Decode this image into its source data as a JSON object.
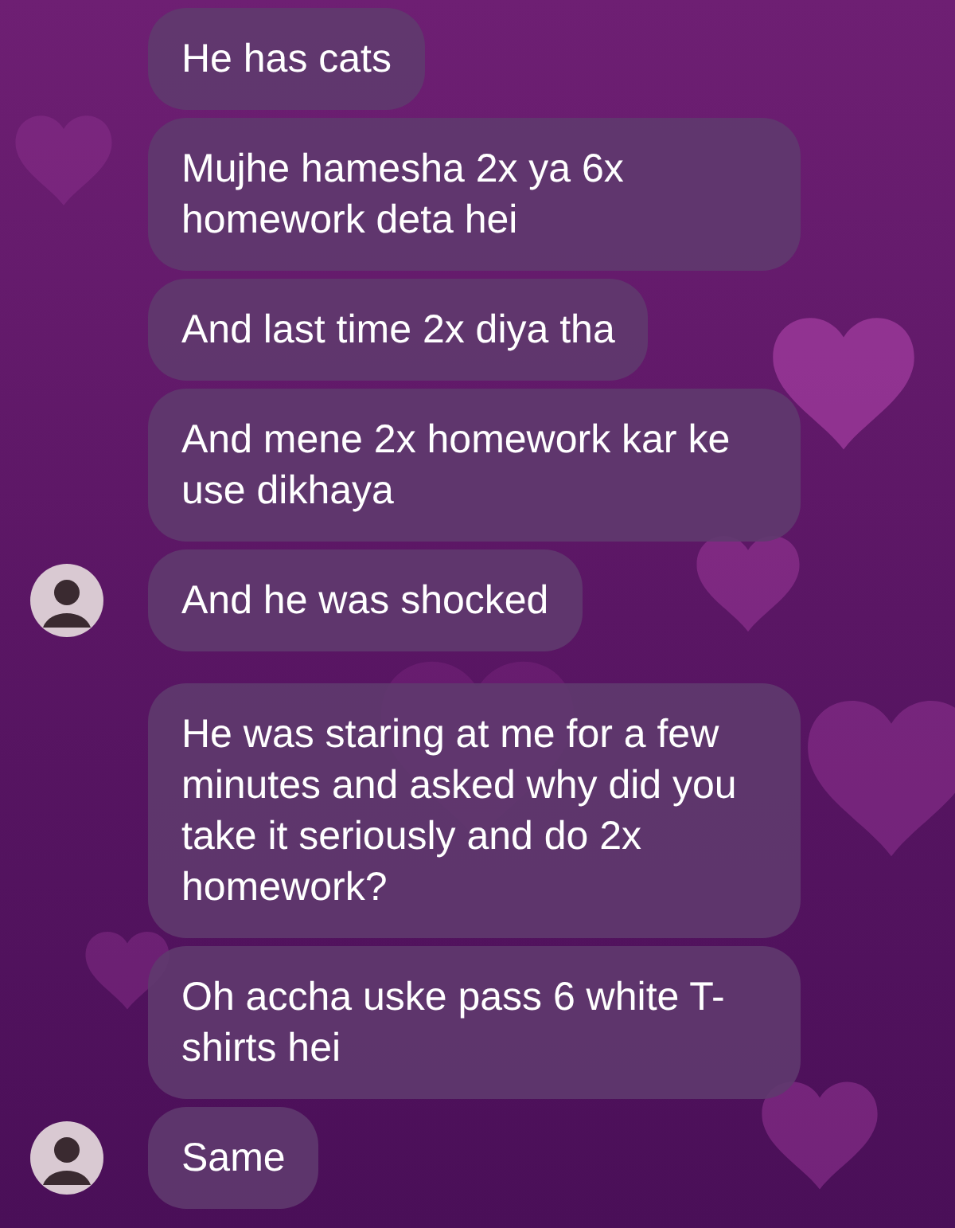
{
  "groups": [
    {
      "avatar": true,
      "messages": [
        "He has cats",
        "Mujhe hamesha 2x ya 6x homework deta hei",
        "And last time 2x diya tha",
        "And mene 2x homework kar ke use dikhaya",
        "And he was shocked"
      ]
    },
    {
      "avatar": true,
      "messages": [
        "He was staring at me for a few minutes and asked why did you take it seriously and do 2x homework?",
        "Oh accha uske pass 6 white T-shirts hei",
        "Same"
      ]
    }
  ]
}
